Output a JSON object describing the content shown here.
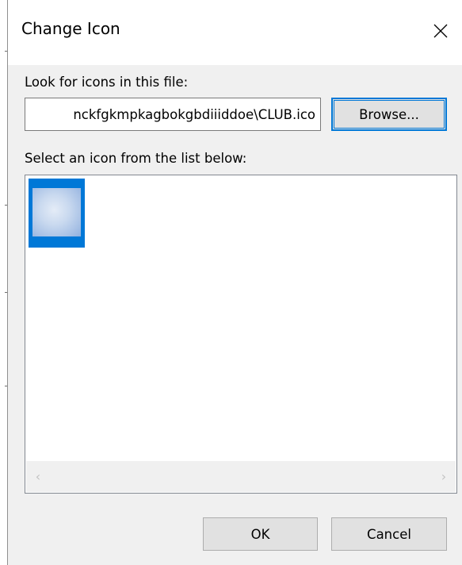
{
  "dialog": {
    "title": "Change Icon",
    "close_icon": "close-icon"
  },
  "file_section": {
    "label": "Look for icons in this file:",
    "path_value": "nckfgkmpkagbokgbdiiiddoe\\CLUB.ico",
    "browse_label": "Browse..."
  },
  "icon_section": {
    "label": "Select an icon from the list below:",
    "items": [
      {
        "name": "club-icon",
        "selected": true
      }
    ]
  },
  "scrollbar": {
    "left_arrow": "‹",
    "right_arrow": "›"
  },
  "footer": {
    "ok_label": "OK",
    "cancel_label": "Cancel"
  },
  "colors": {
    "accent": "#0078d7",
    "dialog_bg": "#f0f0f0",
    "button_bg": "#e1e1e1"
  }
}
